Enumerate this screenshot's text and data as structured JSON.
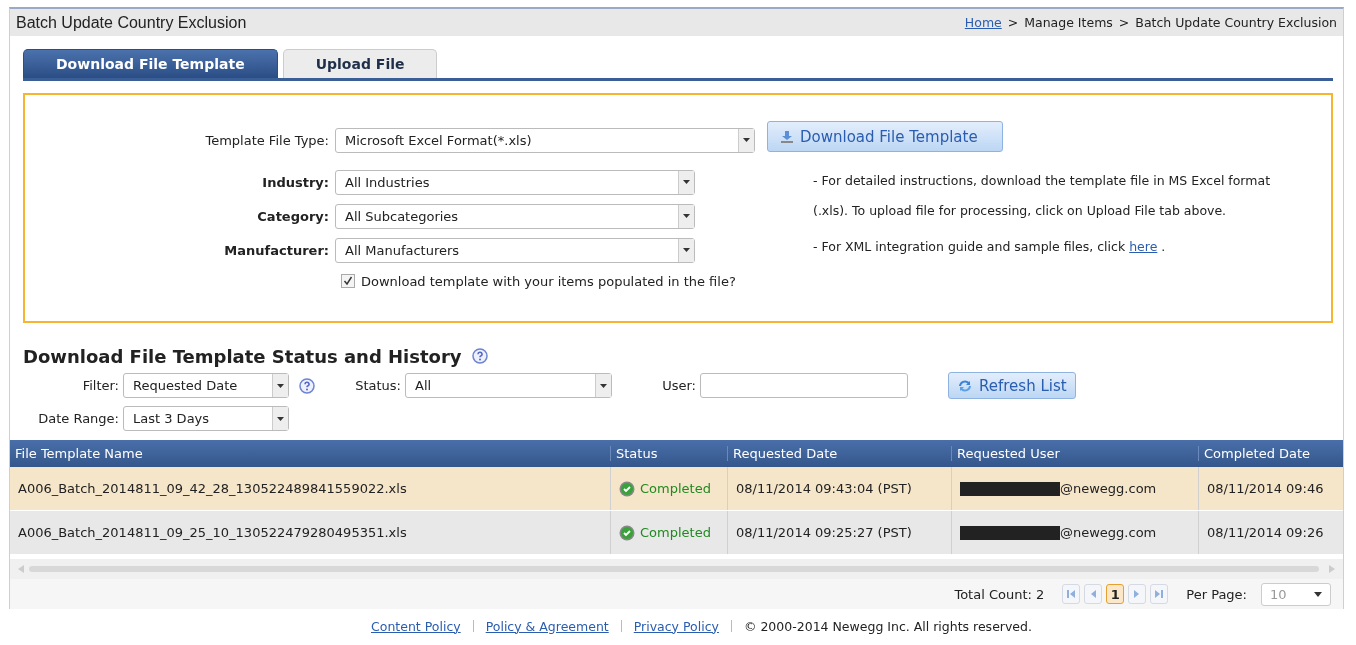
{
  "header": {
    "title": "Batch Update Country Exclusion",
    "breadcrumb": [
      {
        "label": "Home",
        "link": true
      },
      {
        "label": "Manage Items",
        "link": false
      },
      {
        "label": "Batch Update Country Exclusion",
        "link": false
      }
    ],
    "separator": ">"
  },
  "tabs": [
    {
      "label": "Download File Template",
      "selected": true
    },
    {
      "label": "Upload File",
      "selected": false
    }
  ],
  "form": {
    "file_type": {
      "label": "Template File Type:",
      "value": "Microsoft Excel Format(*.xls)"
    },
    "download_button": "Download File Template",
    "selects": [
      {
        "label": "Industry:",
        "value": "All Industries"
      },
      {
        "label": "Category:",
        "value": "All Subcategories"
      },
      {
        "label": "Manufacturer:",
        "value": "All Manufacturers"
      }
    ],
    "populate": {
      "label": "Download template with your items populated in the file?",
      "checked": true
    },
    "notes": [
      "- For detailed instructions, download the template file in MS Excel format",
      "(.xls). To upload file for processing, click on Upload File tab above."
    ],
    "xml_note": {
      "text": "- For XML integration guide and sample files, click",
      "link": "here",
      "end": "."
    }
  },
  "history": {
    "title": "Download File Template Status and History",
    "filter": {
      "label": "Filter:",
      "value": "Requested Date"
    },
    "status": {
      "label": "Status:",
      "value": "All"
    },
    "user": {
      "label": "User:"
    },
    "refresh_button": "Refresh List",
    "date_range": {
      "label": "Date Range:",
      "value": "Last 3 Days"
    }
  },
  "table": {
    "columns": [
      "File Template Name",
      "Status",
      "Requested Date",
      "Requested User",
      "Completed Date"
    ],
    "rows": [
      {
        "selected": true,
        "cells": [
          "A006_Batch_2014811_09_42_28_130522489841559022.xls",
          "Completed",
          "08/11/2014 09:43:04 (PST)",
          "@newegg.com",
          "08/11/2014 09:46"
        ],
        "redacted": true
      },
      {
        "selected": false,
        "cells": [
          "A006_Batch_2014811_09_25_10_130522479280495351.xls",
          "Completed",
          "08/11/2014 09:25:27 (PST)",
          "@newegg.com",
          "08/11/2014 09:26"
        ],
        "redacted": true
      }
    ]
  },
  "pager": {
    "total": "Total Count: 2",
    "page": "1",
    "per_page_label": "Per Page:",
    "per_page": "10"
  },
  "footer": {
    "links": [
      "Content Policy",
      "Policy & Agreement",
      "Privacy Policy"
    ],
    "copyright": "© 2000-2014  Newegg Inc. All rights reserved."
  }
}
